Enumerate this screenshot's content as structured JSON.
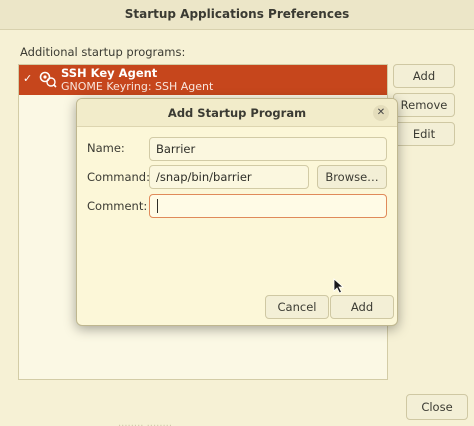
{
  "window": {
    "title": "Startup Applications Preferences",
    "close_glyph": "✕"
  },
  "main": {
    "section_label": "Additional startup programs:",
    "programs": [
      {
        "name": "SSH Key Agent",
        "description": "GNOME Keyring: SSH Agent",
        "enabled": true,
        "check_glyph": "✓",
        "icon": "gear-key-icon"
      }
    ],
    "buttons": {
      "add": "Add",
      "remove": "Remove",
      "edit": "Edit",
      "close": "Close"
    },
    "faint_text": "........ ........"
  },
  "dialog": {
    "title": "Add Startup Program",
    "close_glyph": "✕",
    "name_label": "Name:",
    "name_value": "Barrier",
    "command_label": "Command:",
    "command_value": "/snap/bin/barrier",
    "browse_label": "Browse…",
    "comment_label": "Comment:",
    "comment_value": "",
    "cancel_label": "Cancel",
    "add_label": "Add"
  },
  "colors": {
    "accent": "#c6461c",
    "background": "#f6f1d5",
    "focus_border": "#e08a5a"
  }
}
